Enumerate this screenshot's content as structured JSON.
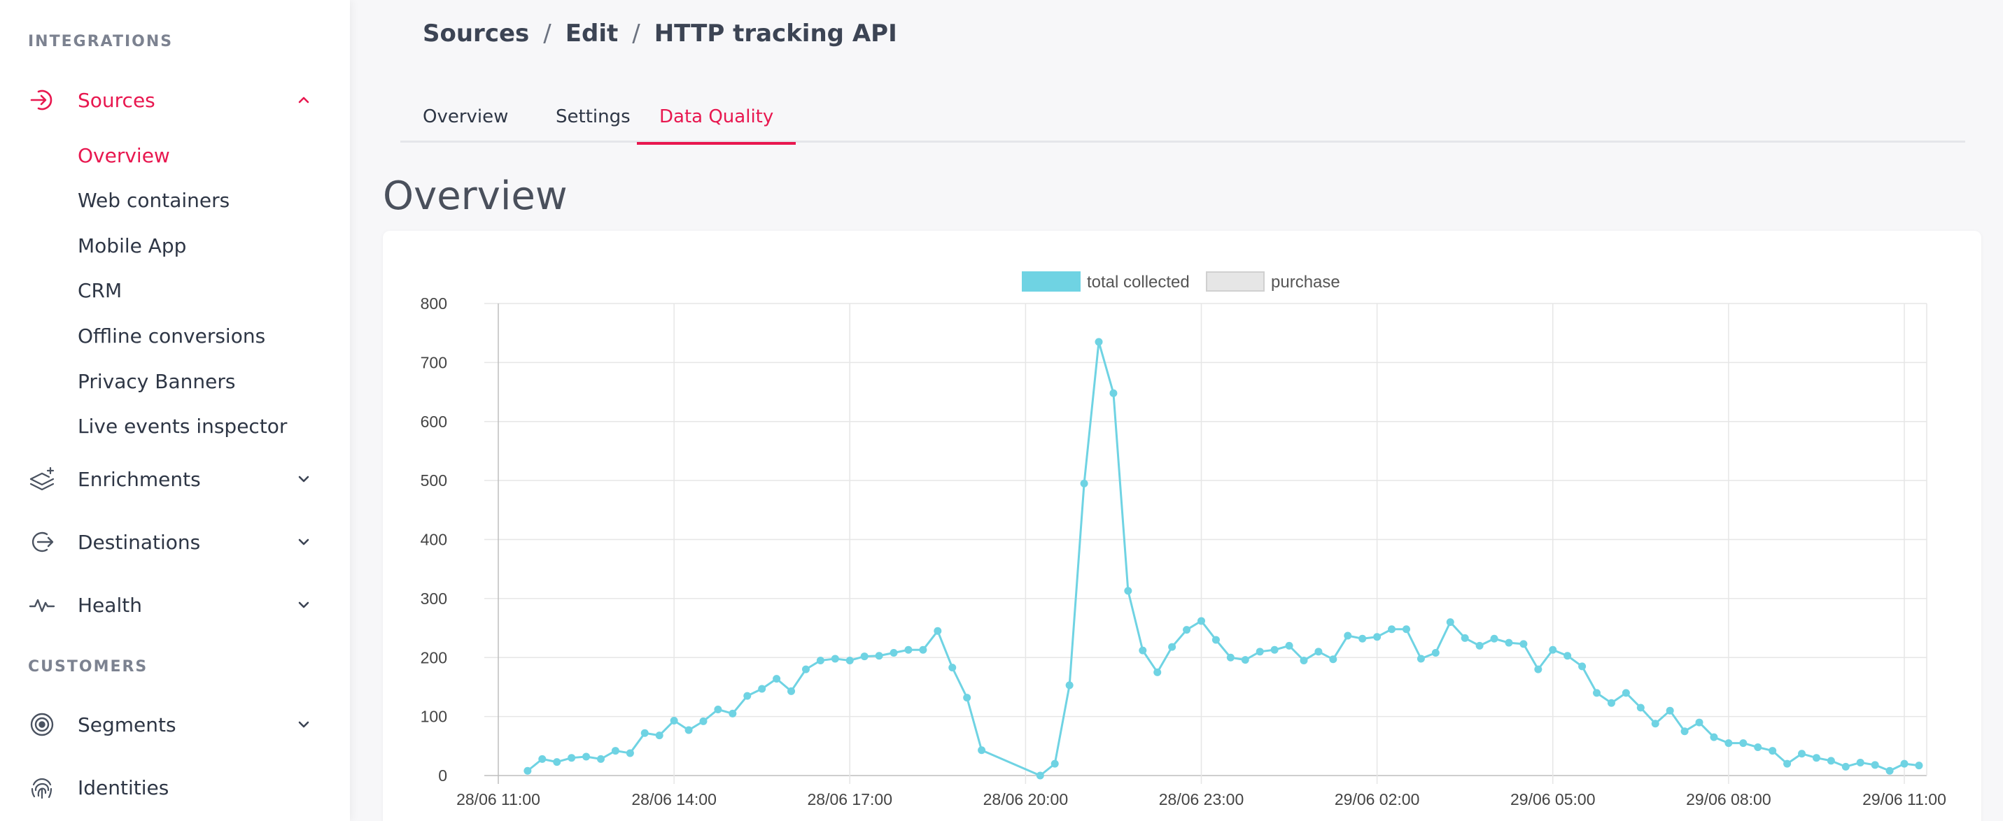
{
  "sidebar": {
    "integrations_title": "INTEGRATIONS",
    "customers_title": "CUSTOMERS",
    "sources": {
      "label": "Sources",
      "icon": "sign-in-icon"
    },
    "sources_items": [
      {
        "label": "Overview",
        "active": true
      },
      {
        "label": "Web containers"
      },
      {
        "label": "Mobile App"
      },
      {
        "label": "CRM"
      },
      {
        "label": "Offline conversions"
      },
      {
        "label": "Privacy Banners"
      },
      {
        "label": "Live events inspector"
      }
    ],
    "enrichments": {
      "label": "Enrichments",
      "icon": "layers-icon"
    },
    "destinations": {
      "label": "Destinations",
      "icon": "sign-out-icon"
    },
    "health": {
      "label": "Health",
      "icon": "pulse-icon"
    },
    "segments": {
      "label": "Segments",
      "icon": "target-icon"
    },
    "identities": {
      "label": "Identities",
      "icon": "fingerprint-icon"
    }
  },
  "breadcrumb": {
    "part1": "Sources",
    "sep1": "/",
    "part2": "Edit",
    "sep2": "/",
    "part3": "HTTP tracking API"
  },
  "tabs": {
    "overview": "Overview",
    "settings": "Settings",
    "data_quality": "Data Quality"
  },
  "page": {
    "heading": "Overview"
  },
  "colors": {
    "accent": "#e8174f",
    "series": "#6fd3e3",
    "purchase": "#e6e6e6"
  },
  "chart_data": {
    "type": "line",
    "legend": [
      "total collected",
      "purchase"
    ],
    "legend_position": "top",
    "grid": true,
    "ylim": [
      0,
      800
    ],
    "yticks": [
      0,
      100,
      200,
      300,
      400,
      500,
      600,
      700,
      800
    ],
    "xticks": [
      "28/06 11:00",
      "28/06 14:00",
      "28/06 17:00",
      "28/06 20:00",
      "28/06 23:00",
      "29/06 02:00",
      "29/06 05:00",
      "29/06 08:00",
      "29/06 11:00"
    ],
    "series": [
      {
        "name": "total collected",
        "points": [
          [
            "28/06 11:30",
            8
          ],
          [
            "28/06 11:45",
            28
          ],
          [
            "28/06 12:00",
            23
          ],
          [
            "28/06 12:15",
            30
          ],
          [
            "28/06 12:30",
            32
          ],
          [
            "28/06 12:45",
            28
          ],
          [
            "28/06 13:00",
            42
          ],
          [
            "28/06 13:15",
            38
          ],
          [
            "28/06 13:30",
            72
          ],
          [
            "28/06 13:45",
            68
          ],
          [
            "28/06 14:00",
            93
          ],
          [
            "28/06 14:15",
            77
          ],
          [
            "28/06 14:30",
            92
          ],
          [
            "28/06 14:45",
            112
          ],
          [
            "28/06 15:00",
            105
          ],
          [
            "28/06 15:15",
            135
          ],
          [
            "28/06 15:30",
            147
          ],
          [
            "28/06 15:45",
            164
          ],
          [
            "28/06 16:00",
            143
          ],
          [
            "28/06 16:15",
            180
          ],
          [
            "28/06 16:30",
            195
          ],
          [
            "28/06 16:45",
            198
          ],
          [
            "28/06 17:00",
            195
          ],
          [
            "28/06 17:15",
            202
          ],
          [
            "28/06 17:30",
            203
          ],
          [
            "28/06 17:45",
            208
          ],
          [
            "28/06 18:00",
            213
          ],
          [
            "28/06 18:15",
            213
          ],
          [
            "28/06 18:30",
            245
          ],
          [
            "28/06 18:45",
            183
          ],
          [
            "28/06 19:00",
            132
          ],
          [
            "28/06 19:15",
            43
          ],
          [
            "28/06 20:15",
            0
          ],
          [
            "28/06 20:30",
            20
          ],
          [
            "28/06 20:45",
            153
          ],
          [
            "28/06 21:00",
            495
          ],
          [
            "28/06 21:15",
            735
          ],
          [
            "28/06 21:30",
            648
          ],
          [
            "28/06 21:45",
            313
          ],
          [
            "28/06 22:00",
            212
          ],
          [
            "28/06 22:15",
            175
          ],
          [
            "28/06 22:30",
            218
          ],
          [
            "28/06 22:45",
            247
          ],
          [
            "28/06 23:00",
            262
          ],
          [
            "28/06 23:15",
            230
          ],
          [
            "28/06 23:30",
            200
          ],
          [
            "28/06 23:45",
            196
          ],
          [
            "29/06 00:00",
            210
          ],
          [
            "29/06 00:15",
            213
          ],
          [
            "29/06 00:30",
            220
          ],
          [
            "29/06 00:45",
            195
          ],
          [
            "29/06 01:00",
            210
          ],
          [
            "29/06 01:15",
            197
          ],
          [
            "29/06 01:30",
            237
          ],
          [
            "29/06 01:45",
            232
          ],
          [
            "29/06 02:00",
            235
          ],
          [
            "29/06 02:15",
            248
          ],
          [
            "29/06 02:30",
            248
          ],
          [
            "29/06 02:45",
            198
          ],
          [
            "29/06 03:00",
            208
          ],
          [
            "29/06 03:15",
            260
          ],
          [
            "29/06 03:30",
            233
          ],
          [
            "29/06 03:45",
            220
          ],
          [
            "29/06 04:00",
            232
          ],
          [
            "29/06 04:15",
            225
          ],
          [
            "29/06 04:30",
            223
          ],
          [
            "29/06 04:45",
            180
          ],
          [
            "29/06 05:00",
            213
          ],
          [
            "29/06 05:15",
            203
          ],
          [
            "29/06 05:30",
            185
          ],
          [
            "29/06 05:45",
            140
          ],
          [
            "29/06 06:00",
            123
          ],
          [
            "29/06 06:15",
            140
          ],
          [
            "29/06 06:30",
            115
          ],
          [
            "29/06 06:45",
            88
          ],
          [
            "29/06 07:00",
            110
          ],
          [
            "29/06 07:15",
            75
          ],
          [
            "29/06 07:30",
            90
          ],
          [
            "29/06 07:45",
            65
          ],
          [
            "29/06 08:00",
            55
          ],
          [
            "29/06 08:15",
            55
          ],
          [
            "29/06 08:30",
            48
          ],
          [
            "29/06 08:45",
            42
          ],
          [
            "29/06 09:00",
            20
          ],
          [
            "29/06 09:15",
            37
          ],
          [
            "29/06 09:30",
            30
          ],
          [
            "29/06 09:45",
            25
          ],
          [
            "29/06 10:00",
            15
          ],
          [
            "29/06 10:15",
            22
          ],
          [
            "29/06 10:30",
            18
          ],
          [
            "29/06 10:45",
            8
          ],
          [
            "29/06 11:00",
            20
          ],
          [
            "29/06 11:15",
            17
          ]
        ]
      }
    ]
  }
}
